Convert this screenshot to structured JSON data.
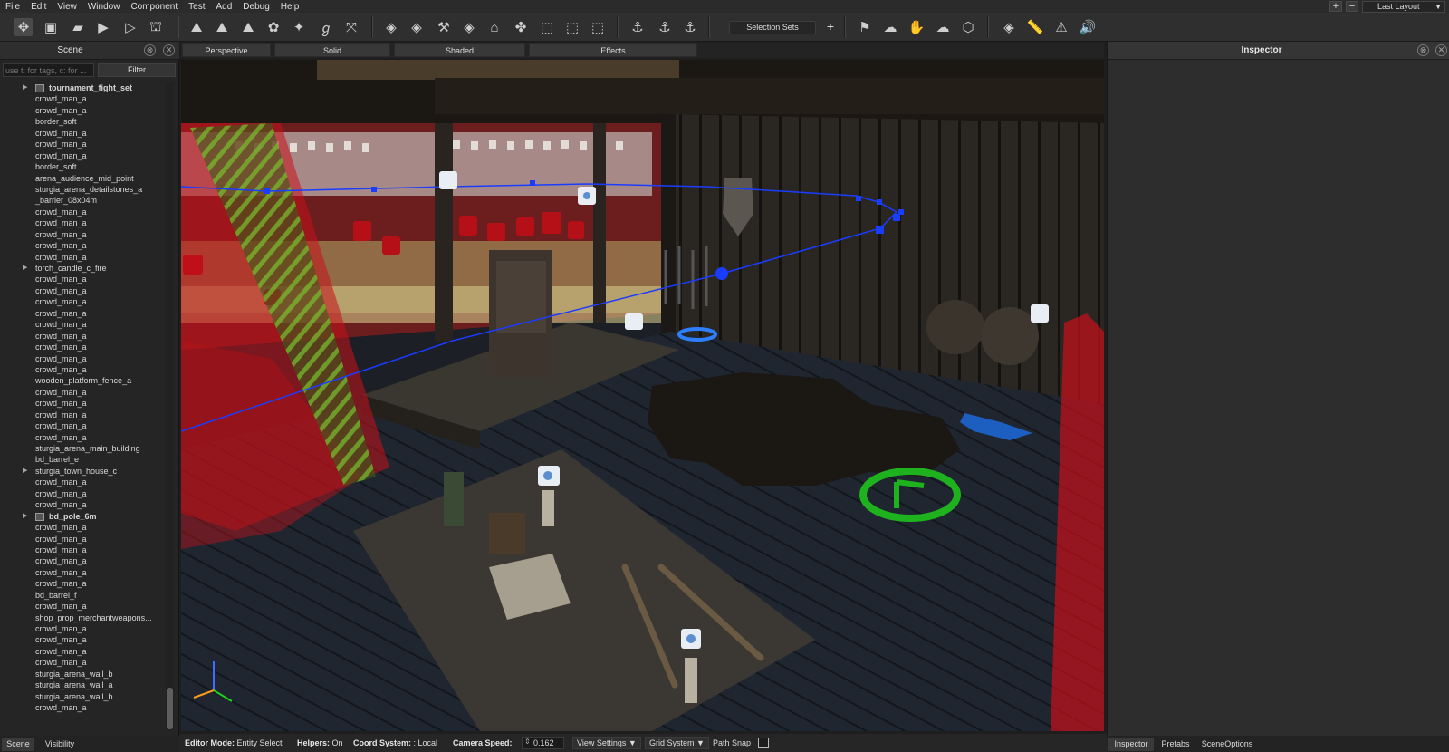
{
  "menu": [
    "File",
    "Edit",
    "View",
    "Window",
    "Component",
    "Test",
    "Add",
    "Debug",
    "Help"
  ],
  "window_controls": {
    "add": "+",
    "remove": "−",
    "layout": "Last Layout"
  },
  "toolbar": {
    "selection_sets_label": "Selection Sets",
    "selection_sets_add": "+",
    "icons": [
      "select-move-icon",
      "save-icon",
      "open-folder-icon",
      "play-icon",
      "play-outline-icon",
      "build-icon",
      "terrain-icon",
      "terrain-smooth-icon",
      "terrain-raise-icon",
      "terrain-paint-icon",
      "terrain-flatten-icon",
      "path-icon",
      "vertex-icon",
      "object-icon",
      "object-place-icon",
      "scatter-icon",
      "cube-icon",
      "flora-icon",
      "cube-select-icon",
      "cube-grid-icon",
      "cube-move-icon",
      "anchor-icon",
      "anchor-add-icon",
      "anchor-remove-icon",
      "map-icon",
      "weather-icon",
      "hand-icon",
      "cloud-icon",
      "navmesh-icon",
      "mesh-icon",
      "measure-icon",
      "warning-icon",
      "sound-icon"
    ]
  },
  "scene_panel": {
    "title": "Scene",
    "search_placeholder": "use t: for tags, c: for ...",
    "filter_label": "Filter",
    "items": [
      {
        "label": "tournament_fight_set",
        "expandable": true,
        "prefab": true
      },
      {
        "label": "crowd_man_a"
      },
      {
        "label": "crowd_man_a"
      },
      {
        "label": "border_soft"
      },
      {
        "label": "crowd_man_a"
      },
      {
        "label": "crowd_man_a"
      },
      {
        "label": "crowd_man_a"
      },
      {
        "label": "border_soft"
      },
      {
        "label": "arena_audience_mid_point"
      },
      {
        "label": "sturgia_arena_detailstones_a"
      },
      {
        "label": "_barrier_08x04m"
      },
      {
        "label": "crowd_man_a"
      },
      {
        "label": "crowd_man_a"
      },
      {
        "label": "crowd_man_a"
      },
      {
        "label": "crowd_man_a"
      },
      {
        "label": "crowd_man_a"
      },
      {
        "label": "torch_candle_c_fire",
        "expandable": true
      },
      {
        "label": "crowd_man_a"
      },
      {
        "label": "crowd_man_a"
      },
      {
        "label": "crowd_man_a"
      },
      {
        "label": "crowd_man_a"
      },
      {
        "label": "crowd_man_a"
      },
      {
        "label": "crowd_man_a"
      },
      {
        "label": "crowd_man_a"
      },
      {
        "label": "crowd_man_a"
      },
      {
        "label": "crowd_man_a"
      },
      {
        "label": "wooden_platform_fence_a"
      },
      {
        "label": "crowd_man_a"
      },
      {
        "label": "crowd_man_a"
      },
      {
        "label": "crowd_man_a"
      },
      {
        "label": "crowd_man_a"
      },
      {
        "label": "crowd_man_a"
      },
      {
        "label": "sturgia_arena_main_building"
      },
      {
        "label": "bd_barrel_e"
      },
      {
        "label": "sturgia_town_house_c",
        "expandable": true
      },
      {
        "label": "crowd_man_a"
      },
      {
        "label": "crowd_man_a"
      },
      {
        "label": "crowd_man_a"
      },
      {
        "label": "bd_pole_6m",
        "expandable": true,
        "prefab": true
      },
      {
        "label": "crowd_man_a"
      },
      {
        "label": "crowd_man_a"
      },
      {
        "label": "crowd_man_a"
      },
      {
        "label": "crowd_man_a"
      },
      {
        "label": "crowd_man_a"
      },
      {
        "label": "crowd_man_a"
      },
      {
        "label": "bd_barrel_f"
      },
      {
        "label": "crowd_man_a"
      },
      {
        "label": "shop_prop_merchantweapons..."
      },
      {
        "label": "crowd_man_a"
      },
      {
        "label": "crowd_man_a"
      },
      {
        "label": "crowd_man_a"
      },
      {
        "label": "crowd_man_a"
      },
      {
        "label": "sturgia_arena_wall_b"
      },
      {
        "label": "sturgia_arena_wall_a"
      },
      {
        "label": "sturgia_arena_wall_b"
      },
      {
        "label": "crowd_man_a"
      }
    ],
    "bottom_tabs": [
      "Scene",
      "Visibility"
    ]
  },
  "viewport": {
    "tabs": [
      "Perspective",
      "Solid",
      "Shaded",
      "Effects"
    ]
  },
  "status_bar": {
    "editor_mode_label": "Editor Mode:",
    "editor_mode_value": "Entity Select",
    "helpers_label": "Helpers:",
    "helpers_value": "On",
    "coord_system_label": "Coord System:",
    "coord_system_value": ": Local",
    "camera_speed_label": "Camera Speed:",
    "camera_speed_value": "0.162",
    "view_settings": "View Settings",
    "grid_system": "Grid System",
    "path_snap": "Path Snap"
  },
  "inspector_panel": {
    "title": "Inspector",
    "bottom_tabs": [
      "Inspector",
      "Prefabs",
      "SceneOptions"
    ]
  },
  "colors": {
    "accent_blue": "#1a3cff",
    "gizmo_green": "#1fb21f",
    "volume_red": "#c8101a"
  }
}
